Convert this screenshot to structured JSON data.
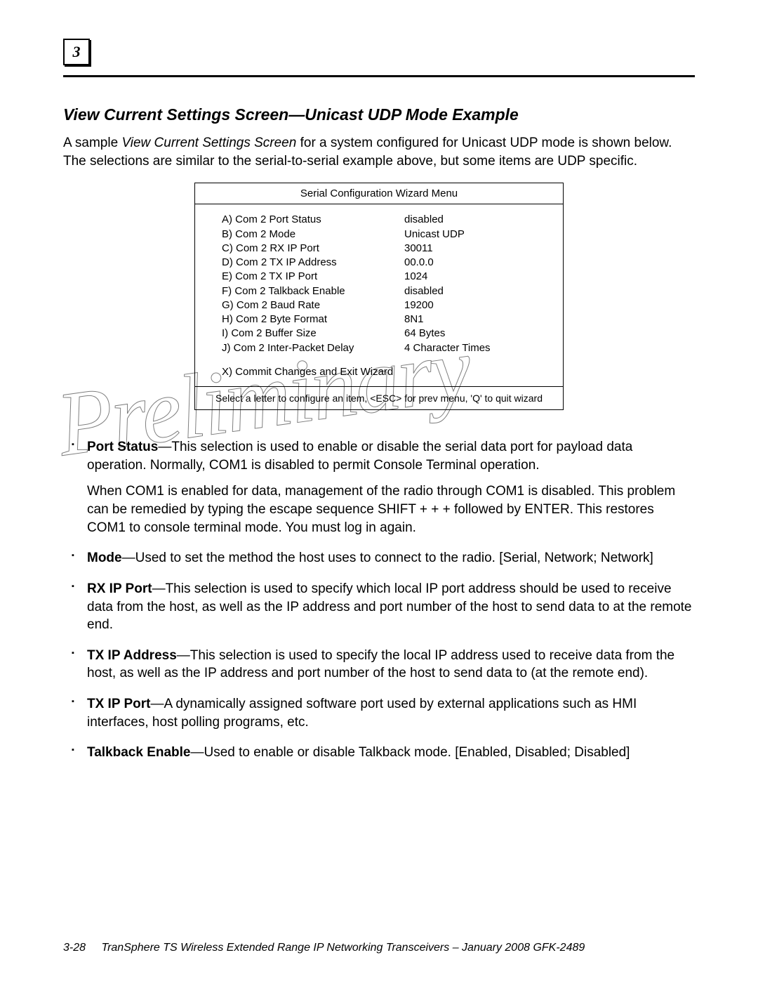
{
  "chapter_number": "3",
  "section_title": "View Current Settings Screen—Unicast UDP Mode Example",
  "intro_pieces": {
    "pre": "A sample ",
    "em": "View Current Settings Screen",
    "post": " for a system configured for Unicast UDP mode is shown below. The selections are similar to the serial-to-serial example above, but some items are UDP specific."
  },
  "menu": {
    "title": "Serial Configuration Wizard Menu",
    "rows": [
      {
        "l": "A) Com 2 Port Status",
        "r": "disabled"
      },
      {
        "l": "B) Com 2 Mode",
        "r": "Unicast UDP"
      },
      {
        "l": "C) Com 2 RX IP Port",
        "r": "30011"
      },
      {
        "l": "D) Com 2 TX IP Address",
        "r": "00.0.0"
      },
      {
        "l": "E) Com 2 TX IP Port",
        "r": "1024"
      },
      {
        "l": "F) Com 2 Talkback Enable",
        "r": "disabled"
      },
      {
        "l": "G) Com 2 Baud Rate",
        "r": "19200"
      },
      {
        "l": "H) Com 2 Byte Format",
        "r": "8N1"
      },
      {
        "l": "I) Com 2 Buffer Size",
        "r": "64 Bytes"
      },
      {
        "l": "J) Com 2 Inter-Packet Delay",
        "r": "4 Character Times"
      }
    ],
    "commit": "X) Commit Changes and Exit Wizard",
    "footer": "Select a letter to configure an item, <ESC> for prev menu, 'Q' to quit wizard"
  },
  "items": [
    {
      "term": "Port Status",
      "body": "—This selection is used to enable or disable the serial data port for payload data operation. Normally, COM1 is disabled to permit Console Terminal operation.",
      "extra": "When COM1 is enabled for data, management of the radio through COM1 is disabled. This problem can be remedied by typing the escape sequence SHIFT + + + followed by ENTER. This restores COM1 to console terminal mode. You must log in again."
    },
    {
      "term": "Mode",
      "body": "—Used to set the method the host uses to connect to the radio. [Serial, Network; Network]"
    },
    {
      "term": "RX IP Port",
      "body": "—This selection is used to specify which local IP port address should be used to receive data from the host, as well as the IP address and port number of the host to send data to at the remote end."
    },
    {
      "term": "TX IP Address",
      "body": "—This selection is used to specify the local IP address used to receive data from the host, as well as the IP address and port number of the host to send data to (at the remote end)."
    },
    {
      "term": "TX IP Port",
      "body": "—A dynamically assigned software port used by external applications such as HMI interfaces, host polling programs, etc."
    },
    {
      "term": "Talkback Enable",
      "body": "—Used to enable or disable Talkback mode. [Enabled, Disabled; Disabled]"
    }
  ],
  "footer": {
    "page": "3-28",
    "title": "TranSphere TS Wireless Extended Range IP Networking Transceivers  –  January 2008    GFK-2489"
  },
  "watermark": "Preliminary"
}
